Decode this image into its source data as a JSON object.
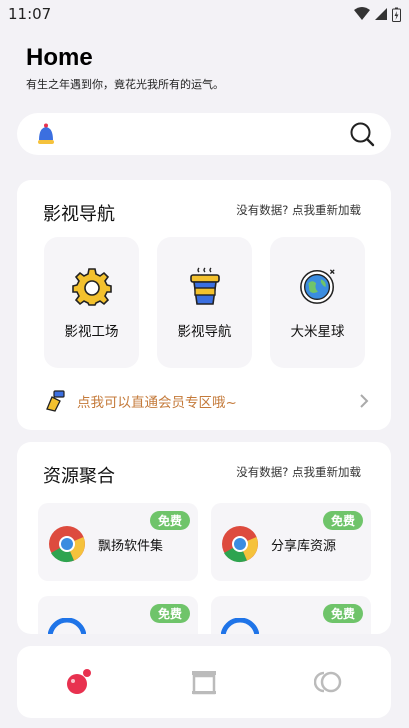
{
  "status_bar": {
    "time": "11:07"
  },
  "header": {
    "title": "Home",
    "subtitle": "有生之年遇到你，竟花光我所有的运气。"
  },
  "search": {
    "bell_icon": "bell-icon",
    "search_icon": "search-icon"
  },
  "section1": {
    "title": "影视导航",
    "reload": "没有数据? 点我重新加载",
    "tiles": [
      {
        "label": "影视工场",
        "icon": "gear-icon"
      },
      {
        "label": "影视导航",
        "icon": "drink-cup-icon"
      },
      {
        "label": "大米星球",
        "icon": "planet-icon"
      }
    ],
    "promo": {
      "text": "点我可以直通会员专区哦~",
      "icon": "hand-bell-icon"
    }
  },
  "section2": {
    "title": "资源聚合",
    "reload": "没有数据? 点我重新加载",
    "items": [
      {
        "name": "飘扬软件集",
        "badge": "免费",
        "icon": "chrome-icon"
      },
      {
        "name": "分享库资源",
        "badge": "免费",
        "icon": "chrome-icon"
      },
      {
        "name": "",
        "badge": "免费",
        "icon": "blue-circle-icon"
      },
      {
        "name": "",
        "badge": "免费",
        "icon": "blue-circle-icon"
      }
    ]
  },
  "tabbar": {
    "tabs": [
      {
        "icon": "home-dot-icon"
      },
      {
        "icon": "archive-icon"
      },
      {
        "icon": "rings-icon"
      }
    ]
  },
  "colors": {
    "accent": "#e8314f",
    "badge": "#6fc46a",
    "promo_text": "#c47a3a",
    "background": "#f3f2f6"
  }
}
